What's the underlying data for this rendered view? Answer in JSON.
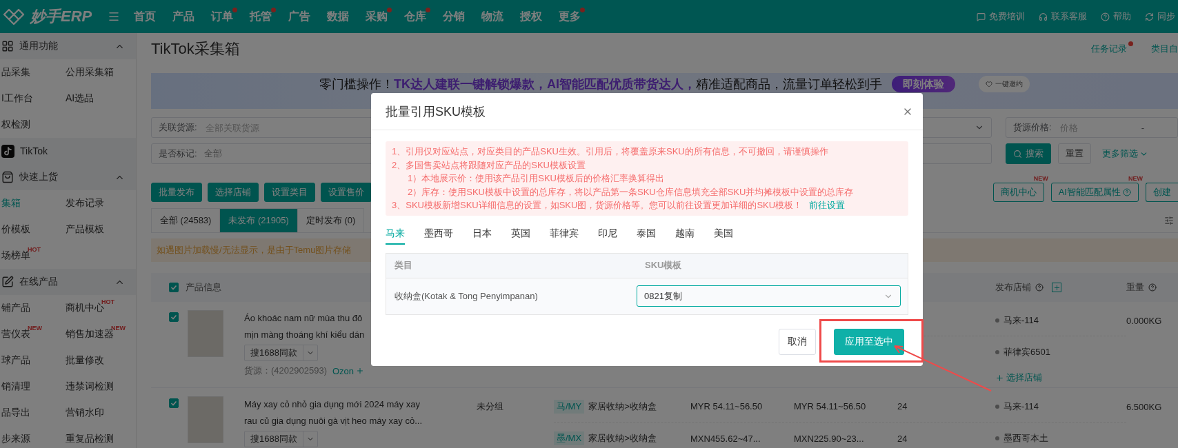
{
  "topbar": {
    "logo": "妙手ERP",
    "nav": [
      {
        "label": "首页",
        "dot": false
      },
      {
        "label": "产品",
        "dot": false
      },
      {
        "label": "订单",
        "dot": true
      },
      {
        "label": "托管",
        "dot": true
      },
      {
        "label": "广告",
        "dot": false
      },
      {
        "label": "数据",
        "dot": false
      },
      {
        "label": "采购",
        "dot": true
      },
      {
        "label": "仓库",
        "dot": true
      },
      {
        "label": "分销",
        "dot": false
      },
      {
        "label": "物流",
        "dot": false
      },
      {
        "label": "授权",
        "dot": false
      },
      {
        "label": "更多",
        "dot": true
      }
    ],
    "links": [
      "免费培训",
      "联系客服",
      "帮助",
      "同步"
    ]
  },
  "sidebar": {
    "sections": [
      {
        "title": "通用功能",
        "kind": "group",
        "expanded": true,
        "items": [
          {
            "label": "品采集",
            "selected": false
          },
          {
            "label": "公用采集箱",
            "selected": false
          },
          {
            "label": "I工作台",
            "selected": false
          },
          {
            "label": "AI选品",
            "selected": false
          },
          {
            "label": "权检测",
            "selected": false
          }
        ]
      },
      {
        "title": "TikTok",
        "kind": "platform"
      },
      {
        "title": "快速上货",
        "kind": "group",
        "expanded": true,
        "items": [
          {
            "label": "集箱",
            "selected": true
          },
          {
            "label": "发布记录",
            "selected": false
          },
          {
            "label": "价模板",
            "selected": false
          },
          {
            "label": "产品模板",
            "selected": false
          },
          {
            "label": "场榜单",
            "selected": false,
            "badge": "HOT"
          }
        ]
      },
      {
        "title": "在线产品",
        "kind": "group",
        "expanded": true,
        "items": [
          {
            "label": "铺产品",
            "selected": false
          },
          {
            "label": "商机中心",
            "selected": false,
            "badge": "HOT"
          },
          {
            "label": "营仪表",
            "selected": false,
            "badge": "NEW"
          },
          {
            "label": "销售加速器",
            "selected": false,
            "badge": "NEW"
          },
          {
            "label": "球产品",
            "selected": false
          },
          {
            "label": "批量修改",
            "selected": false
          },
          {
            "label": "销清理",
            "selected": false
          },
          {
            "label": "违禁词检测",
            "selected": false
          },
          {
            "label": "品导出",
            "selected": false
          },
          {
            "label": "营销水印",
            "selected": false
          },
          {
            "label": "步来源",
            "selected": false
          },
          {
            "label": "重复品检测",
            "selected": false
          }
        ]
      }
    ]
  },
  "page": {
    "title": "TikTok采集箱",
    "header_links": [
      {
        "label": "任务记录",
        "dot": true
      },
      {
        "label": "类目自",
        "dot": false
      }
    ],
    "banner": {
      "text": "零门槛操作！**TK达人建联一键解锁爆款，AI智能匹配优质带货达人，**精准适配商品，流量订单轻松到手",
      "cta": "即刻体验",
      "invite": "一键邀约"
    },
    "filters": {
      "source": {
        "label": "关联货源:",
        "placeholder": "全部关联货源"
      },
      "price": {
        "label": "货源价格:",
        "placeholder": "价格",
        "separator": "-"
      },
      "mark": {
        "label": "是否标记:",
        "value": "全部"
      },
      "search": "搜索",
      "reset": "重置",
      "more": "更多筛选"
    },
    "actions": [
      "批量发布",
      "选择店铺",
      "设置类目",
      "设置售价"
    ],
    "right_actions": [
      {
        "label": "商机中心",
        "badge": "NEW",
        "help": false
      },
      {
        "label": "AI智能匹配属性",
        "badge": "NEW",
        "help": true
      },
      {
        "label": "创建",
        "help": false
      }
    ],
    "tabs": [
      {
        "label": "全部 (24583)",
        "selected": false
      },
      {
        "label": "未发布 (21905)",
        "selected": true
      },
      {
        "label": "定时发布 (0)",
        "selected": false
      }
    ],
    "notice": "如遇图片加载慢/无法显示，是由于Temu图片存储",
    "table": {
      "all_checked": true,
      "columns": {
        "product": "产品信息",
        "store": "发布店铺",
        "weight": "重量"
      },
      "rows": [
        {
          "checked": true,
          "title_lines": [
            "Áo khoác nam nữ mùa thu đô",
            "mịn màng thoáng khí kiểu dán"
          ],
          "source_button": "搜1688同款",
          "source": "货源：(4202902593)",
          "platform": "Ozon",
          "sites": [
            {
              "store": "马来-114"
            },
            {
              "store": "菲律宾6501"
            }
          ],
          "add_store": "选择店铺",
          "weight": "0.000KG"
        },
        {
          "checked": true,
          "title_lines": [
            "Máy xay cỏ nhỏ gia dụng mới 2024 máy xay",
            "rau củ gia dụng nuôi gà vịt heo máy xay cỏ..."
          ],
          "source_button": "搜1688同款",
          "group": "未分组",
          "sites": [
            {
              "tag": "马/MY",
              "category": "家居收纳>收纳盒",
              "price": "MYR 54.11~56.50",
              "original_price": "MYR 54.11~56.50",
              "stock": "24",
              "store": "马来-114"
            },
            {
              "tag": "墨/MX",
              "category": "家居收纳>收纳盒",
              "price": "MXN455.62~47...",
              "original_price": "MXN225.90~23...",
              "stock": "24",
              "store": "墨西哥本土"
            }
          ],
          "weight": "6.500KG"
        }
      ]
    }
  },
  "modal": {
    "title": "批量引用SKU模板",
    "notice": [
      {
        "text": "1、引用仅对应站点，对应类目的产品SKU生效。引用后，将覆盖原来SKU的所有信息，不可撤回，请谨慎操作"
      },
      {
        "text": "2、多国售卖站点将跟随对应产品的SKU模板设置",
        "children": [
          {
            "text": "1）本地展示价：使用该产品引用SKU模板后的价格汇率换算得出"
          },
          {
            "text": "2）库存：使用SKU模板中设置的总库存，将以产品第一条SKU仓库信息填充全部SKU并均摊模板中设置的总库存"
          }
        ]
      },
      {
        "text": "3、SKU模板新增SKU详细信息的设置，如SKU图，货源价格等。您可以前往设置更加详细的SKU模板！",
        "link": "前往设置"
      }
    ],
    "tabs": [
      {
        "label": "马来",
        "selected": true
      },
      {
        "label": "墨西哥",
        "selected": false
      },
      {
        "label": "日本",
        "selected": false
      },
      {
        "label": "英国",
        "selected": false
      },
      {
        "label": "菲律宾",
        "selected": false
      },
      {
        "label": "印尼",
        "selected": false
      },
      {
        "label": "泰国",
        "selected": false
      },
      {
        "label": "越南",
        "selected": false
      },
      {
        "label": "美国",
        "selected": false
      }
    ],
    "table": {
      "columns": [
        "类目",
        "SKU模板"
      ],
      "rows": [
        {
          "category": "收纳盒(Kotak & Tong Penyimpanan)",
          "template": "0821复制"
        }
      ]
    },
    "buttons": [
      {
        "label": "取消",
        "kind": "default",
        "highlighted": false
      },
      {
        "label": "应用至选中",
        "kind": "primary",
        "highlighted": true
      }
    ]
  }
}
